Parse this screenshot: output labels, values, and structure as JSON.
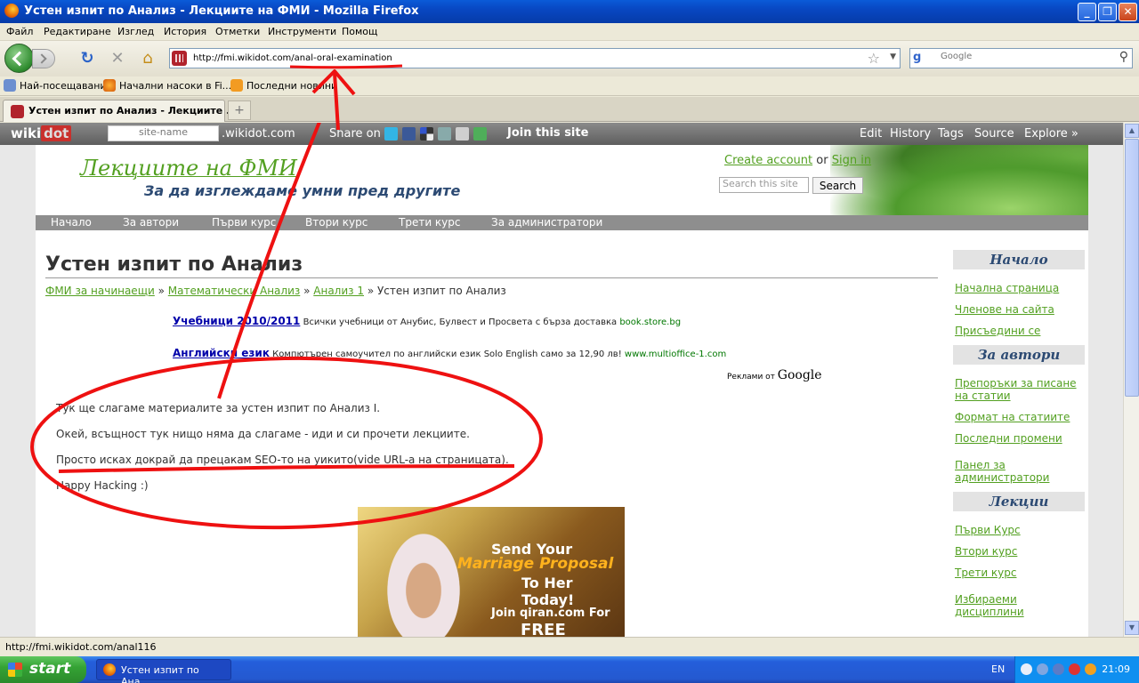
{
  "window": {
    "title": "Устен изпит по Анализ - Лекциите на ФМИ - Mozilla Firefox",
    "min": "_",
    "max": "❐",
    "close": "✕"
  },
  "menu": [
    "Файл",
    "Редактиране",
    "Изглед",
    "История",
    "Отметки",
    "Инструменти",
    "Помощ"
  ],
  "navbar": {
    "url": "http://fmi.wikidot.com/anal-oral-examination",
    "search_placeholder": "Google",
    "search_engine": "g"
  },
  "bookmarks": [
    "Най-посещавани",
    "Начални насоки в Fi...",
    "Последни новини"
  ],
  "tab": {
    "label": "Устен изпит по Анализ - Лекциите ...",
    "new_tab": "+"
  },
  "wikidot": {
    "logo_a": "wiki",
    "logo_b": "dot",
    "site_placeholder": "site-name",
    "domain": ".wikidot.com",
    "share": "Share on",
    "join": "Join this site",
    "actions": [
      "Edit",
      "History",
      "Tags",
      "Source",
      "Explore »"
    ]
  },
  "site": {
    "name": "Лекциите на ФМИ",
    "tagline": "За да изглеждаме умни пред другите",
    "create_account": "Create account",
    "or": "or",
    "sign_in": "Sign in",
    "search_placeholder": "Search this site",
    "search_button": "Search"
  },
  "topnav": [
    "Начало",
    "За автори",
    "Първи курс",
    "Втори курс",
    "Трети курс",
    "За администратори"
  ],
  "page": {
    "title": "Устен изпит по Анализ",
    "breadcrumbs": [
      "ФМИ за начинаещи",
      "Математически Анализ",
      "Анализ 1"
    ],
    "breadcrumb_sep": "»",
    "breadcrumb_current": "Устен изпит по Анализ",
    "ads": [
      {
        "title": "Учебници 2010/2011",
        "text": "Всички учебници от Анубис, Булвест и Просвета с бърза доставка",
        "url": "book.store.bg"
      },
      {
        "title": "Английски език",
        "text": "Компютърен самоучител по английски език Solo English само за 12,90 лв!",
        "url": "www.multioffice-1.com"
      }
    ],
    "ads_by": "Реклами от",
    "ads_google": "Google",
    "paragraphs": [
      "Тук ще слагаме материалите за устен изпит по Анализ I.",
      "Окей, всъщност тук нищо няма да слагаме - иди и си прочети лекциите.",
      "Просто исках докрай да прецакам SEO-то на уикито(vide URL-а на страницата).",
      "Happy Hacking :)"
    ],
    "banner": {
      "line1": "Send Your",
      "line2": "Marriage Proposal",
      "line3": "To Her Today!",
      "line4": "Join qiran.com For",
      "line5": "FREE"
    }
  },
  "sidebar": {
    "sections": [
      {
        "heading": "Начало",
        "links": [
          "Начална страница",
          "Членове на сайта",
          "Присъедини се"
        ]
      },
      {
        "heading": "За автори",
        "links": [
          "Препоръки за писане на статии",
          "Формат на статиите",
          "Последни промени",
          "Панел за администратори"
        ]
      },
      {
        "heading": "Лекции",
        "links": [
          "Първи Курс",
          "Втори курс",
          "Трети курс",
          "Избираеми дисциплини"
        ]
      }
    ]
  },
  "status": "http://fmi.wikidot.com/anal116",
  "taskbar": {
    "start": "start",
    "task": "Устен изпит по Ана...",
    "lang": "EN",
    "clock": "21:09"
  },
  "colors": {
    "annotation": "#ee1111",
    "link_green": "#53a021",
    "heading_blue": "#2c4a73"
  }
}
